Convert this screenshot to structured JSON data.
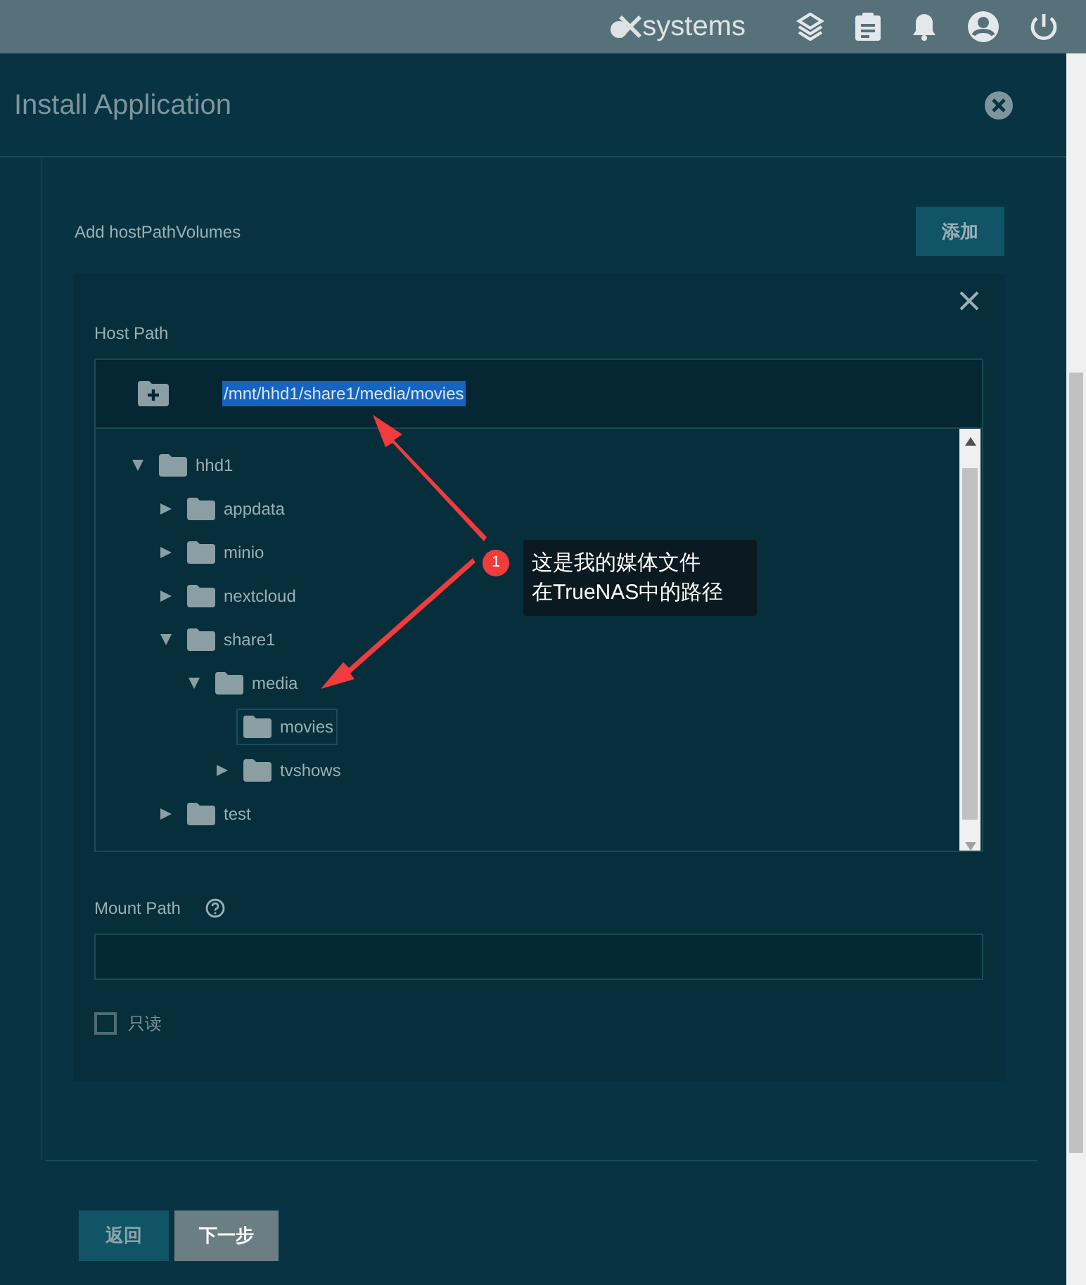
{
  "topbar": {
    "logo": "systems"
  },
  "dialog": {
    "title": "Install Application"
  },
  "section": {
    "label": "Add hostPathVolumes",
    "add_button": "添加"
  },
  "host_path": {
    "label": "Host Path",
    "value": "/mnt/hhd1/share1/media/movies",
    "tree": [
      {
        "name": "hhd1",
        "expandable": true,
        "expanded": true,
        "selected": false,
        "children": [
          {
            "name": "appdata",
            "expandable": true,
            "expanded": false,
            "selected": false
          },
          {
            "name": "minio",
            "expandable": true,
            "expanded": false,
            "selected": false
          },
          {
            "name": "nextcloud",
            "expandable": true,
            "expanded": false,
            "selected": false
          },
          {
            "name": "share1",
            "expandable": true,
            "expanded": true,
            "selected": false,
            "children": [
              {
                "name": "media",
                "expandable": true,
                "expanded": true,
                "selected": false,
                "children": [
                  {
                    "name": "movies",
                    "expandable": false,
                    "expanded": false,
                    "selected": true
                  },
                  {
                    "name": "tvshows",
                    "expandable": true,
                    "expanded": false,
                    "selected": false
                  }
                ]
              }
            ]
          },
          {
            "name": "test",
            "expandable": true,
            "expanded": false,
            "selected": false
          }
        ]
      }
    ]
  },
  "mount_path": {
    "label": "Mount Path"
  },
  "readonly": {
    "label": "只读",
    "checked": false
  },
  "buttons": [
    {
      "label": "返回",
      "kind": "back"
    },
    {
      "label": "下一步",
      "kind": "next"
    }
  ],
  "annotation": {
    "badge": "1",
    "lines": [
      "这是我的媒体文件",
      "在TrueNAS中的路径"
    ]
  }
}
